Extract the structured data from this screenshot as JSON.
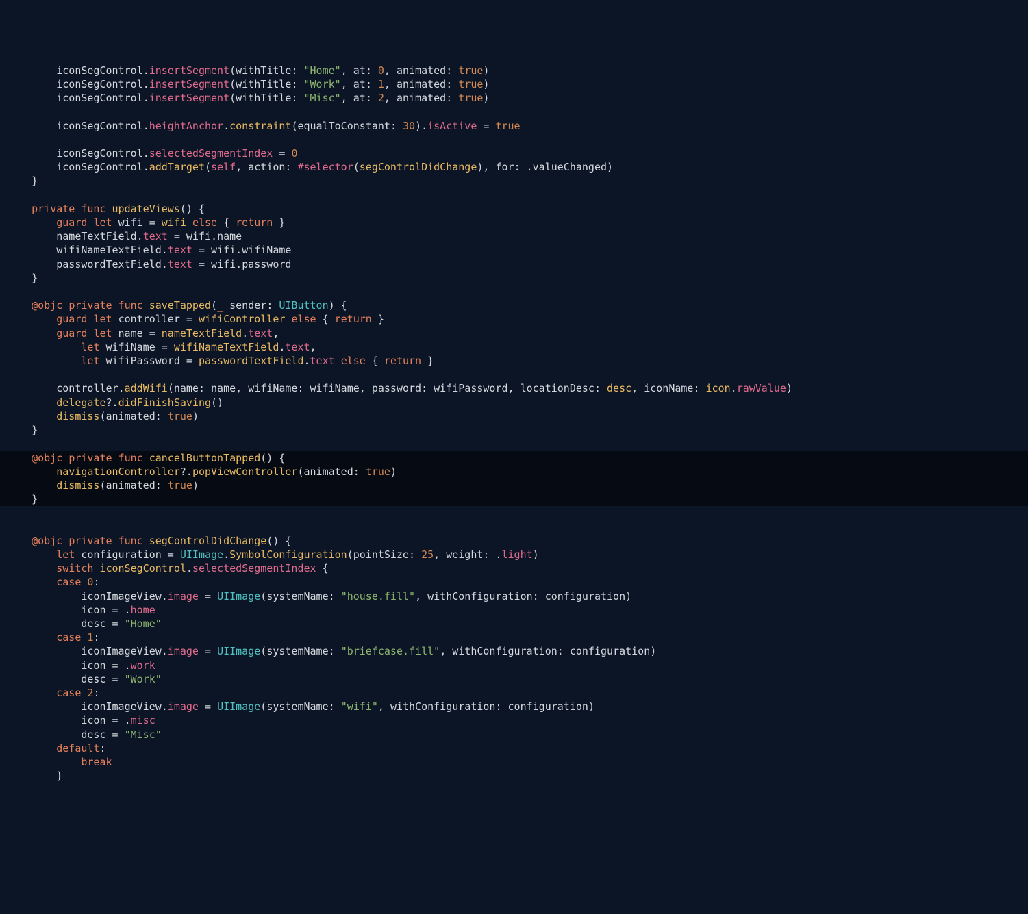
{
  "tokens": {
    "iconSegControl": "iconSegControl",
    "insertSegment": "insertSegment",
    "withTitle": "withTitle",
    "home": "\"Home\"",
    "work": "\"Work\"",
    "misc": "\"Misc\"",
    "at": "at",
    "n0": "0",
    "n1": "1",
    "n2": "2",
    "n25": "25",
    "n30": "30",
    "animated": "animated",
    "true": "true",
    "heightAnchor": "heightAnchor",
    "constraint": "constraint",
    "equalToConstant": "equalToConstant",
    "isActive": "isActive",
    "selectedSegmentIndex": "selectedSegmentIndex",
    "addTarget": "addTarget",
    "self": "self",
    "action": "action",
    "selector": "#selector",
    "segControlDidChange": "segControlDidChange",
    "for": "for",
    "valueChanged": "valueChanged",
    "private": "private",
    "func": "func",
    "updateViews": "updateViews",
    "guard": "guard",
    "let": "let",
    "wifi": "wifi",
    "else": "else",
    "return": "return",
    "nameTextField": "nameTextField",
    "text": "text",
    "name": "name",
    "wifiNameTextField": "wifiNameTextField",
    "wifiName": "wifiName",
    "passwordTextField": "passwordTextField",
    "password": "password",
    "objc": "@objc",
    "saveTapped": "saveTapped",
    "sender": "sender",
    "UIButton": "UIButton",
    "controller": "controller",
    "wifiController": "wifiController",
    "wifiPassword": "wifiPassword",
    "addWifi": "addWifi",
    "locationDesc": "locationDesc",
    "desc": "desc",
    "iconName": "iconName",
    "icon": "icon",
    "rawValue": "rawValue",
    "delegate": "delegate",
    "didFinishSaving": "didFinishSaving",
    "dismiss": "dismiss",
    "cancelButtonTapped": "cancelButtonTapped",
    "navigationController": "navigationController",
    "popViewController": "popViewController",
    "configuration": "configuration",
    "UIImage": "UIImage",
    "SymbolConfiguration": "SymbolConfiguration",
    "pointSize": "pointSize",
    "weight": "weight",
    "light": "light",
    "switch": "switch",
    "case": "case",
    "iconImageView": "iconImageView",
    "image": "image",
    "systemName": "systemName",
    "houseFill": "\"house.fill\"",
    "withConfiguration": "withConfiguration",
    "dotHome": "home",
    "homeStr": "\"Home\"",
    "briefcaseFill": "\"briefcase.fill\"",
    "dotWork": "work",
    "workStr": "\"Work\"",
    "wifiStr": "\"wifi\"",
    "dotMisc": "misc",
    "miscStr": "\"Misc\"",
    "default": "default",
    "break": "break"
  }
}
